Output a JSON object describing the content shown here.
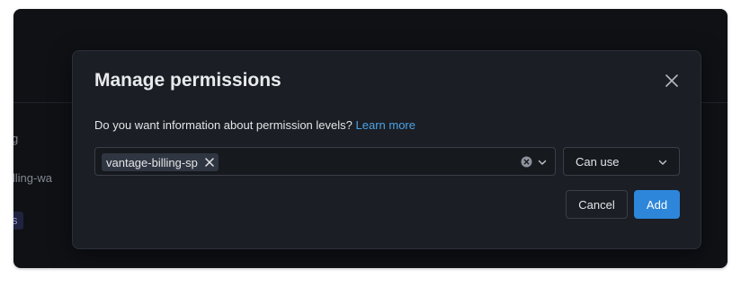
{
  "background": {
    "item_1": "g",
    "item_2": "illing-wa",
    "chip": "s"
  },
  "dialog": {
    "title": "Manage permissions",
    "info_text": "Do you want information about permission levels?",
    "learn_more_link": "Learn more",
    "selected_principal": "vantage-billing-sp",
    "permission_level": "Can use",
    "cancel_label": "Cancel",
    "add_label": "Add"
  },
  "icons": {
    "close": "close-icon",
    "tag_remove": "close-icon",
    "clear": "clear-circle-icon",
    "dropdown": "chevron-down-icon"
  },
  "colors": {
    "primary": "#2d86d9",
    "link": "#4ba3e6",
    "modal_background": "#1b1e24",
    "page_background": "#121419"
  }
}
